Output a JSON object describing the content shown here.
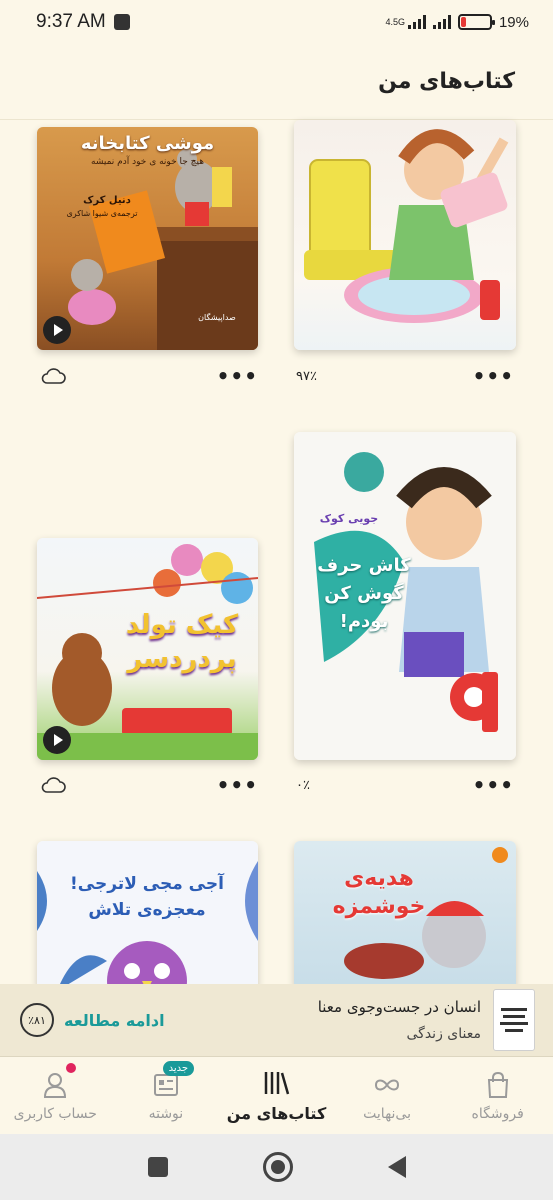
{
  "status_bar": {
    "time": "9:37 AM",
    "network": "4.5G",
    "battery": "19%",
    "battery_level": 0.19
  },
  "header": {
    "title": "کتاب‌های من"
  },
  "books": [
    {
      "cover_title": "موشی کتابخانه",
      "cover_subtitle": "هیچ جا خونه ی خود آدم نمیشه",
      "author": "دنیل کرک",
      "translator": "ترجمه‌ی شیوا شاکری",
      "narrators": "صداپیشگان",
      "has_audio": true,
      "status": "cloud",
      "progress_text": ""
    },
    {
      "cover_title": "",
      "cover_subtitle": "",
      "has_audio": false,
      "status": "progress",
      "progress_text": "۹۷٪"
    },
    {
      "cover_title": "کیک تولد پردردسر",
      "cover_subtitle": "",
      "has_audio": true,
      "status": "cloud",
      "progress_text": ""
    },
    {
      "cover_title": "کاش حرف گوش کن بودم!",
      "cover_subtitle": "جویی کوک",
      "has_audio": false,
      "status": "progress",
      "progress_text": "۰٪"
    },
    {
      "cover_title": "آجی مجی لاترجی! معجزه‌ی تلاش",
      "cover_subtitle": "",
      "has_audio": false,
      "status": "",
      "progress_text": ""
    },
    {
      "cover_title": "هدیه‌ی خوشمزه",
      "cover_subtitle": "",
      "has_audio": false,
      "status": "",
      "progress_text": ""
    }
  ],
  "continue_reading": {
    "title": "انسان در جست‌وجوی معنا",
    "subtitle": "معنای زندگی",
    "action": "ادامه مطالعه",
    "progress": "٪۸۱",
    "thumb_text": "انسان در جست‌وجوی معنا"
  },
  "bottom_nav": {
    "items": [
      {
        "label": "حساب کاربری",
        "icon": "user-icon"
      },
      {
        "label": "نوشته",
        "icon": "notes-icon",
        "badge": "جدید"
      },
      {
        "label": "کتاب‌های من",
        "icon": "library-icon",
        "active": true
      },
      {
        "label": "بی‌نهایت",
        "icon": "infinity-icon"
      },
      {
        "label": "فروشگاه",
        "icon": "shopping-bag-icon"
      }
    ]
  },
  "colors": {
    "background": "#fcf7e8",
    "accent": "#1a9a99",
    "badge_dot": "#e0245e"
  }
}
